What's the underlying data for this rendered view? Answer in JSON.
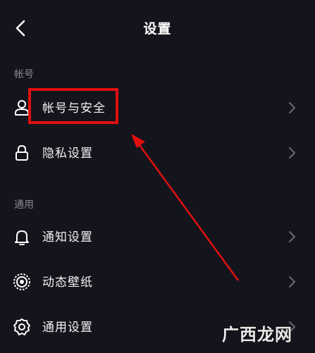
{
  "header": {
    "title": "设置"
  },
  "sections": {
    "account": {
      "label": "帐号",
      "items": [
        {
          "label": "帐号与安全",
          "icon": "user-icon"
        },
        {
          "label": "隐私设置",
          "icon": "lock-icon"
        }
      ]
    },
    "general": {
      "label": "通用",
      "items": [
        {
          "label": "通知设置",
          "icon": "bell-icon"
        },
        {
          "label": "动态壁纸",
          "icon": "live-wallpaper-icon"
        },
        {
          "label": "通用设置",
          "icon": "gear-icon"
        }
      ]
    }
  },
  "annotation": {
    "color": "#e01010"
  },
  "watermark": {
    "text": "广西龙网"
  }
}
